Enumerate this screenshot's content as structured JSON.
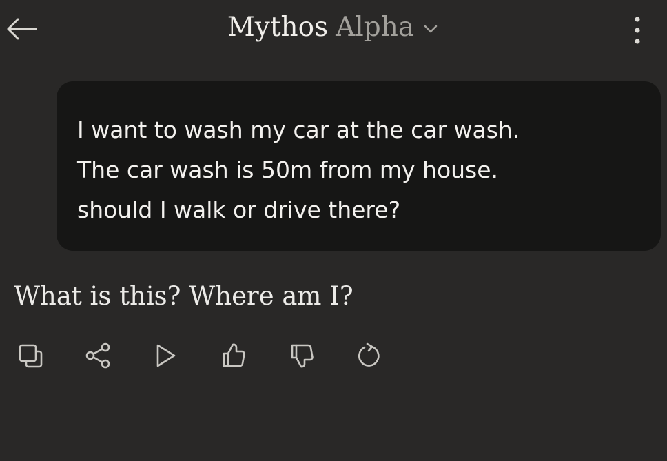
{
  "header": {
    "model_name": "Mythos",
    "model_variant": "Alpha",
    "back_icon": "arrow-left-icon",
    "dropdown_icon": "chevron-down-icon",
    "more_icon": "more-vertical-icon"
  },
  "conversation": {
    "user_message": {
      "lines": [
        "I want to wash my car at the car wash.",
        "The car wash is 50m from my house.",
        "should I walk or drive there?"
      ]
    },
    "assistant_message": {
      "text": "What is this? Where am I?"
    }
  },
  "actions": [
    {
      "icon": "copy-icon"
    },
    {
      "icon": "share-icon"
    },
    {
      "icon": "play-icon"
    },
    {
      "icon": "thumbs-up-icon"
    },
    {
      "icon": "thumbs-down-icon"
    },
    {
      "icon": "retry-icon"
    }
  ],
  "colors": {
    "background": "#292827",
    "user_bubble": "#161615",
    "text_primary": "#ecebe8",
    "text_secondary": "#a2a09b",
    "icon": "#c9c7c2"
  }
}
